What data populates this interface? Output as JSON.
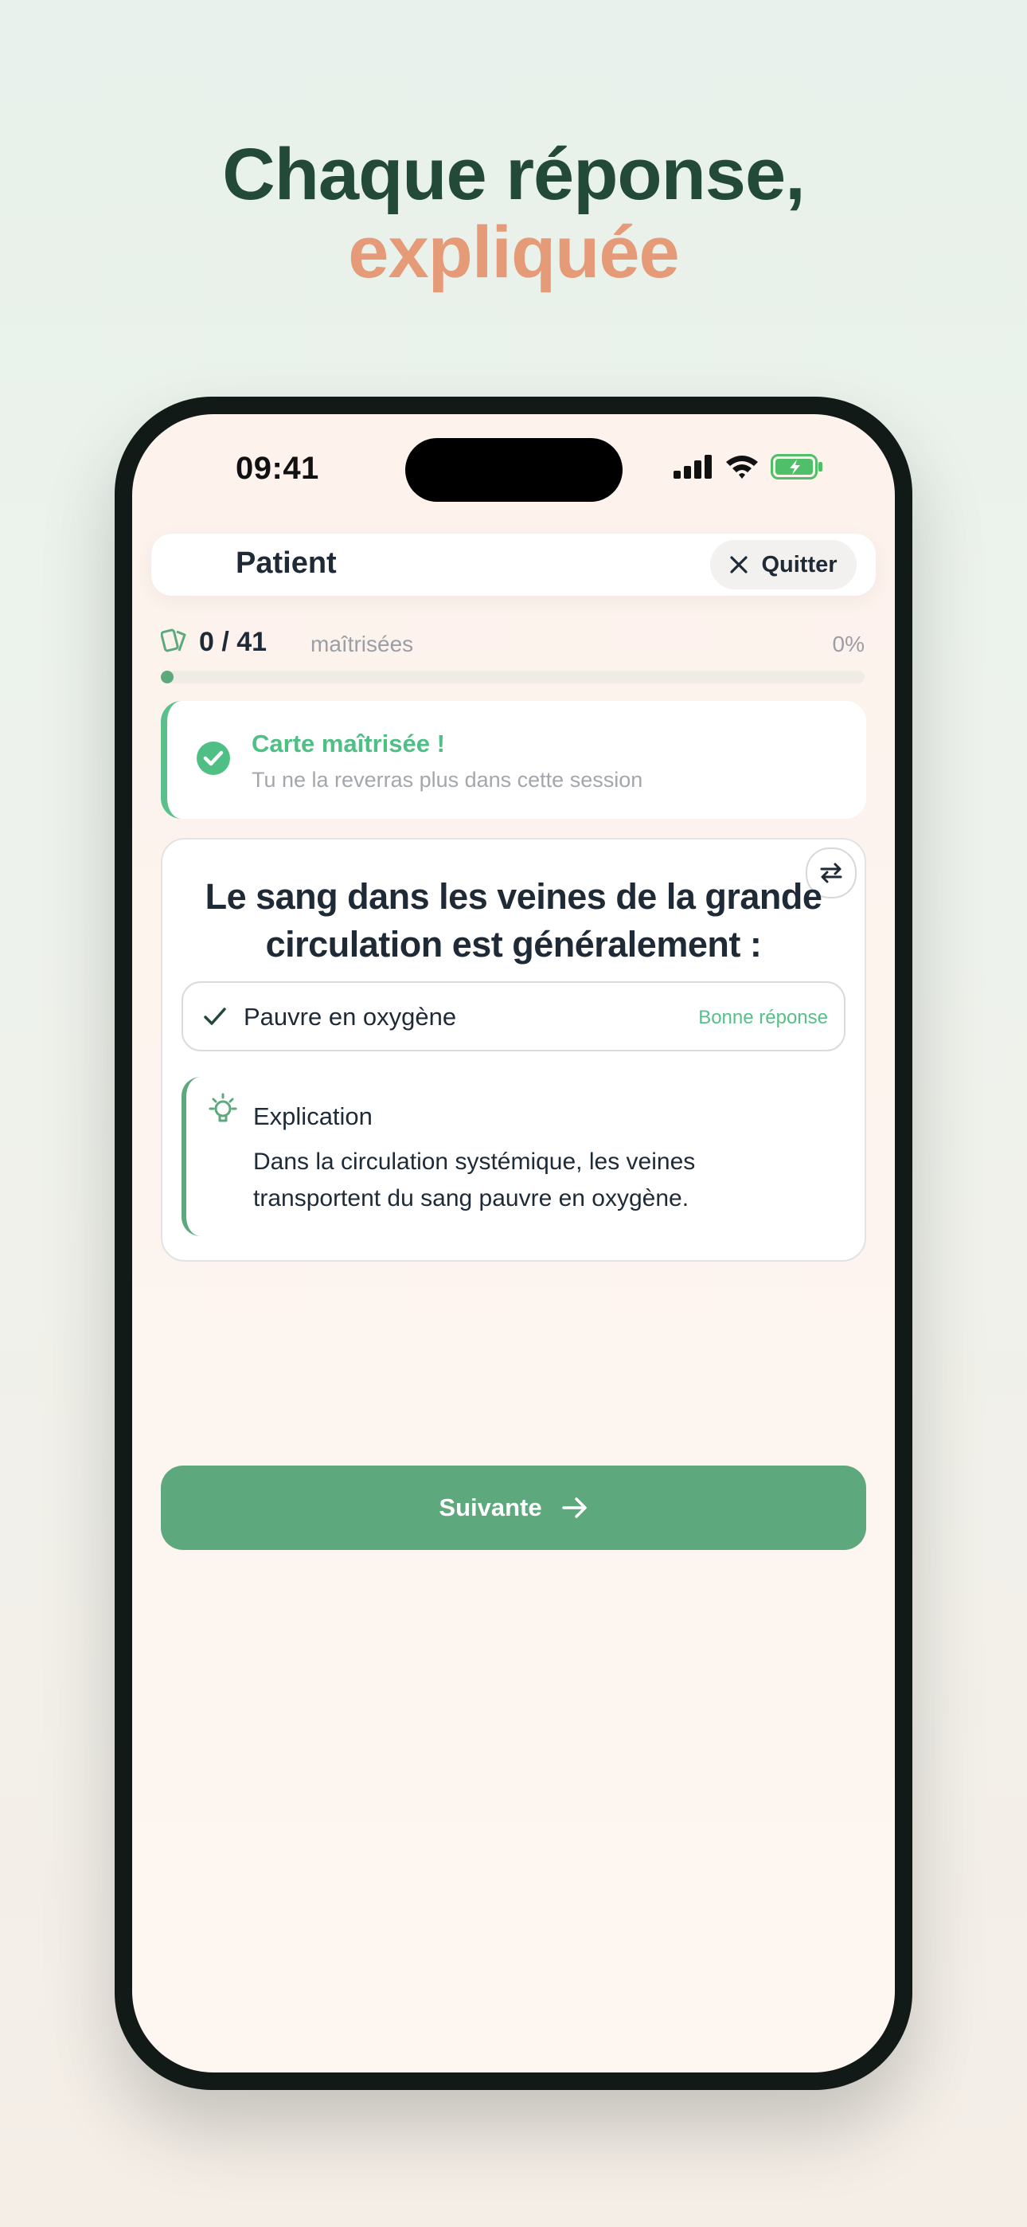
{
  "headline": {
    "line1": "Chaque réponse,",
    "line2": "expliquée"
  },
  "status_bar": {
    "time": "09:41"
  },
  "topbar": {
    "title": "Patient",
    "quit_label": "Quitter"
  },
  "progress": {
    "mastered_count": "0 / 41",
    "mastered_label": "maîtrisées",
    "percent_text": "0%",
    "fraction": 0.0
  },
  "mastered_banner": {
    "title": "Carte maîtrisée !",
    "subtitle": "Tu ne la reverras plus dans cette session"
  },
  "card": {
    "question": "Le sang dans les veines de la grande circulation est généralement :",
    "answer": "Pauvre en oxygène",
    "answer_badge": "Bonne réponse",
    "explanation_title": "Explication",
    "explanation_body": "Dans la circulation systémique, les veines transportent du sang pauvre en oxygène."
  },
  "next_button": {
    "label": "Suivante"
  },
  "colors": {
    "brand_green": "#5ea87d",
    "accent_orange": "#e59a78",
    "success_green": "#4fbf85",
    "dark_green": "#234a39"
  },
  "icons": [
    "x-close-icon",
    "cards-icon",
    "check-circle-icon",
    "swap-icon",
    "check-icon",
    "lightbulb-icon",
    "arrow-right-icon",
    "signal-icon",
    "wifi-icon",
    "battery-icon"
  ]
}
